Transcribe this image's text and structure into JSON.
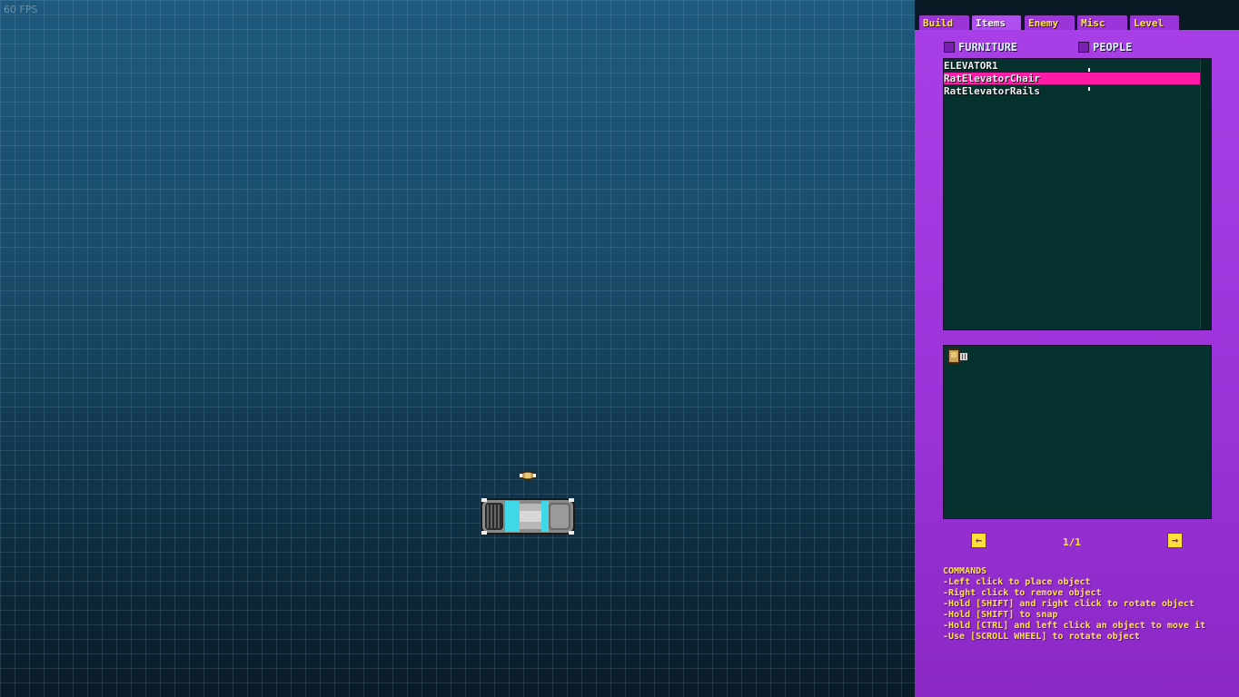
{
  "fps": "60 FPS",
  "tabs": [
    "Build",
    "Items",
    "Enemy",
    "Misc",
    "Level"
  ],
  "active_tab": "Items",
  "categories": {
    "furniture": "FURNITURE",
    "people": "PEOPLE"
  },
  "items": [
    "ELEVATOR1",
    "RatElevatorChair",
    "RatElevatorRails"
  ],
  "selected_item": "RatElevatorChair",
  "pager": {
    "page": "1/1",
    "prev_icon": "left-arrow-icon",
    "next_icon": "right-arrow-icon"
  },
  "commands": {
    "title": "COMMANDS",
    "lines": [
      "-Left click to place object",
      "-Right click to remove object",
      "-Hold [SHIFT] and right click to rotate object",
      "-Hold [SHIFT] to snap",
      "-Hold [CTRL] and left click an object to move it",
      "-Use [SCROLL WHEEL] to rotate object"
    ]
  },
  "colors": {
    "panel": "#9b34d9",
    "list_bg": "#05312f",
    "selection": "#ff1aa8",
    "accent_text": "#ffe838"
  }
}
